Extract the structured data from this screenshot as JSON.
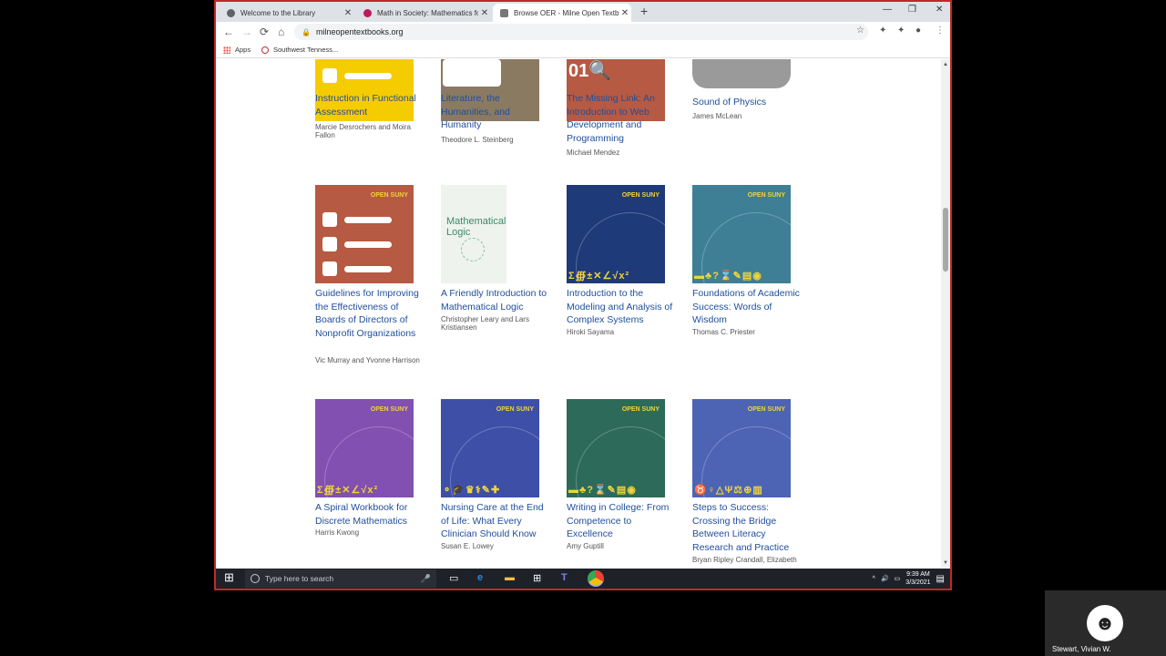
{
  "browser": {
    "tabs": [
      {
        "title": "Welcome to the Library",
        "favicon_color": "#5f6368"
      },
      {
        "title": "Math in Society: Mathematics for",
        "favicon_color": "#c2185b"
      },
      {
        "title": "Browse OER - Milne Open Textbo",
        "favicon_color": "#777777"
      }
    ],
    "url": "milneopentextbooks.org",
    "bookmarks": [
      "Apps",
      "Southwest Tenness..."
    ]
  },
  "icons": {
    "back": "←",
    "forward": "→",
    "reload": "⟳",
    "home": "⌂",
    "lock": "🔒",
    "star": "☆",
    "extension": "✦",
    "profile": "●",
    "menu": "⋮",
    "close": "✕",
    "new_tab": "+",
    "minimize": "—",
    "restore": "❐",
    "windows": "⊞",
    "mic": "🎤",
    "taskview": "▭",
    "scroll_up": "▲",
    "scroll_down": "▼"
  },
  "books": [
    {
      "title": "Instruction in Functional Assessment",
      "author": "Marcie Desrochers and Moira Fallon",
      "cover": "#f5cc00"
    },
    {
      "title": "Literature, the Humanities, and Humanity",
      "author": "Theodore L. Steinberg",
      "cover": "#8a7a62"
    },
    {
      "title": "The Missing Link: An Introduction to Web Development and Programming",
      "author": "Michael Mendez",
      "cover": "#b65a43"
    },
    {
      "title": "Sound of Physics",
      "author": "James McLean",
      "cover": "#9a9a9a"
    },
    {
      "title": "Guidelines for Improving the Effectiveness of Boards of Directors of Nonprofit Organizations",
      "author": "Vic Murray and Yvonne Harrison",
      "cover": "#b65a43",
      "brand": "OPEN SUNY"
    },
    {
      "title": "A Friendly Introduction to Mathematical Logic",
      "author": "Christopher Leary and Lars Kristiansen",
      "cover": "#eef3ee",
      "cover_text": "Mathematical Logic"
    },
    {
      "title": "Introduction to the Modeling and Analysis of Complex Systems",
      "author": "Hiroki Sayama",
      "cover": "#1e3a78",
      "brand": "OPEN SUNY"
    },
    {
      "title": "Foundations of Academic Success: Words of Wisdom",
      "author": "Thomas C. Priester",
      "cover": "#3e7f95",
      "brand": "OPEN SUNY"
    },
    {
      "title": "A Spiral Workbook for Discrete Mathematics",
      "author": "Harris Kwong",
      "cover": "#8250b0",
      "brand": "OPEN SUNY"
    },
    {
      "title": "Nursing Care at the End of Life: What Every Clinician Should Know",
      "author": "Susan E. Lowey",
      "cover": "#3e4fa8",
      "brand": "OPEN SUNY"
    },
    {
      "title": "Writing in College: From Competence to Excellence",
      "author": "Amy Guptill",
      "cover": "#2d6a5a",
      "brand": "OPEN SUNY"
    },
    {
      "title": "Steps to Success: Crossing the Bridge Between Literacy Research and Practice",
      "author": "Bryan Ripley Crandall, Elizabeth Lewis, Elizabeth Y.",
      "cover": "#4d64b5",
      "brand": "OPEN SUNY"
    }
  ],
  "taskbar": {
    "search_placeholder": "Type here to search",
    "time": "9:39 AM",
    "date": "3/3/2021"
  },
  "participant": {
    "name": "Stewart, Vivian W."
  }
}
